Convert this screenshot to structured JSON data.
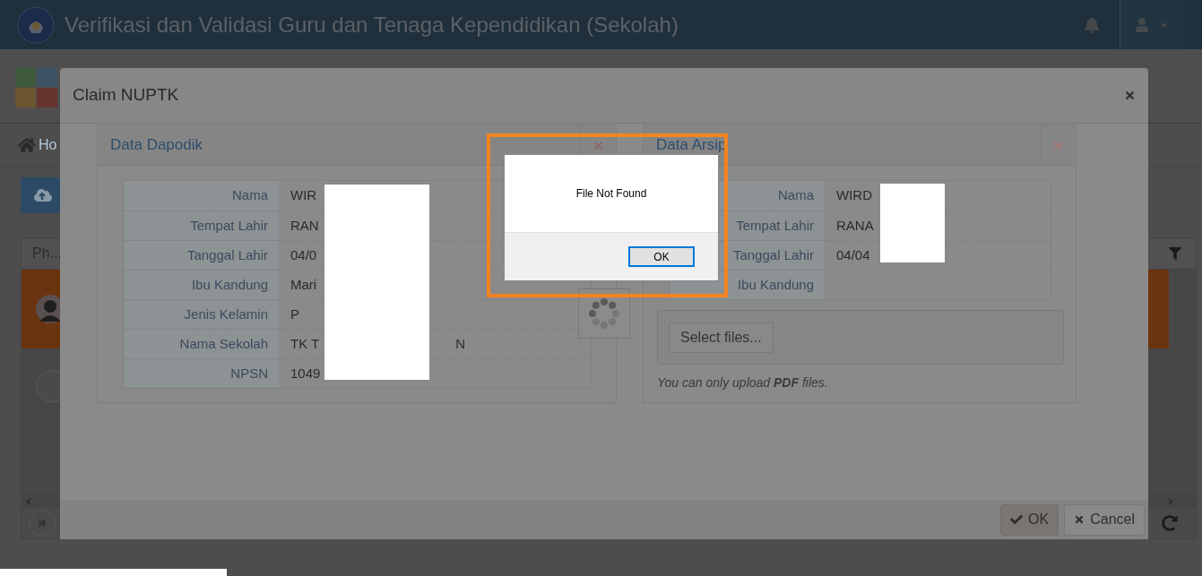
{
  "header": {
    "title": "Verifikasi dan Validasi Guru dan Tenaga Kependidikan (Sekolah)"
  },
  "breadcrumb": {
    "label": "Ho"
  },
  "grid": {
    "column_1": "Ph..."
  },
  "modal": {
    "title": "Claim NUPTK",
    "panels": [
      {
        "title": "Data Dapodik",
        "rows": [
          {
            "label": "Nama",
            "value": "WIR"
          },
          {
            "label": "Tempat Lahir",
            "value": "RAN"
          },
          {
            "label": "Tanggal Lahir",
            "value": "04/0"
          },
          {
            "label": "Ibu Kandung",
            "value": "Mari"
          },
          {
            "label": "Jenis Kelamin",
            "value": "P"
          },
          {
            "label": "Nama Sekolah",
            "value": "TK T",
            "value_end": "N"
          },
          {
            "label": "NPSN",
            "value": "1049"
          }
        ]
      },
      {
        "title": "Data Arsip",
        "rows": [
          {
            "label": "Nama",
            "value": "WIRD"
          },
          {
            "label": "Tempat Lahir",
            "value": "RANA"
          },
          {
            "label": "Tanggal Lahir",
            "value": "04/04"
          },
          {
            "label": "Ibu Kandung",
            "value": ""
          }
        ],
        "upload_button": "Select files...",
        "hint": "You can only upload **PDF** files."
      }
    ],
    "buttons": [
      {
        "label": "OK",
        "kind": "primary"
      },
      {
        "label": "Cancel",
        "kind": "cancel"
      }
    ]
  },
  "alert": {
    "message": "File Not Found",
    "button": "OK"
  }
}
